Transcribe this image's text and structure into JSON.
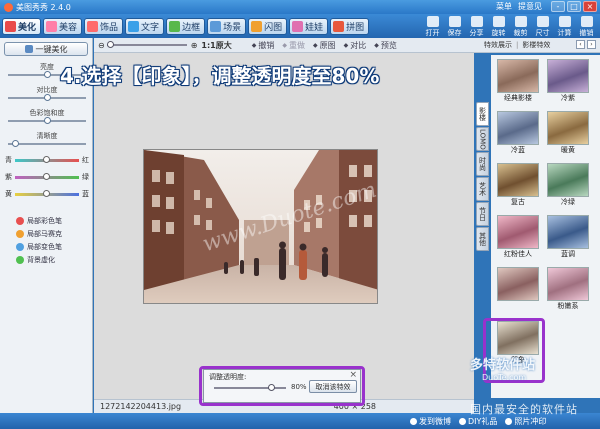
{
  "window": {
    "title": "美图秀秀 2.4.0",
    "menu": [
      "菜单",
      "提意见"
    ],
    "controls": [
      "-",
      "□",
      "×"
    ]
  },
  "tabs": [
    {
      "label": "美化",
      "color": "#e94b4b",
      "active": true
    },
    {
      "label": "美容",
      "color": "#ff7fa8",
      "active": false
    },
    {
      "label": "饰品",
      "color": "#ff6b6b",
      "active": false
    },
    {
      "label": "文字",
      "color": "#3aa0e8",
      "active": false
    },
    {
      "label": "边框",
      "color": "#58b84c",
      "active": false
    },
    {
      "label": "场景",
      "color": "#5c9ad8",
      "active": false
    },
    {
      "label": "闪图",
      "color": "#f0a030",
      "active": false
    },
    {
      "label": "娃娃",
      "color": "#e070b0",
      "active": false
    },
    {
      "label": "拼图",
      "color": "#e8583c",
      "active": false
    }
  ],
  "toolbar_buttons": [
    "打开",
    "保存",
    "分享",
    "旋转",
    "裁剪",
    "尺寸",
    "计算",
    "撤销"
  ],
  "left": {
    "one_click": "一键美化",
    "sliders": [
      {
        "label": "亮度",
        "value": 0.5
      },
      {
        "label": "对比度",
        "value": 0.5
      },
      {
        "label": "色彩饱和度",
        "value": 0.5
      },
      {
        "label": "清晰度",
        "value": 0.05
      }
    ],
    "color_rows": [
      {
        "left": "青",
        "right": "红",
        "gradient": [
          "#3cc8c8",
          "#e85050"
        ]
      },
      {
        "left": "紫",
        "right": "绿",
        "gradient": [
          "#c060c0",
          "#50c050"
        ]
      },
      {
        "left": "黄",
        "right": "蓝",
        "gradient": [
          "#e8d040",
          "#4a70e0"
        ]
      }
    ],
    "tools": [
      {
        "label": "局部彩色笔",
        "color": "#e85050"
      },
      {
        "label": "局部马赛克",
        "color": "#f0a030"
      },
      {
        "label": "局部变色笔",
        "color": "#50a0e0"
      },
      {
        "label": "背景虚化",
        "color": "#50c050"
      }
    ]
  },
  "work": {
    "zoom_text": "1:1原大",
    "actions": [
      {
        "label": "撤销",
        "dim": false
      },
      {
        "label": "重做",
        "dim": true
      },
      {
        "label": "原图",
        "dim": false
      },
      {
        "label": "对比",
        "dim": false
      },
      {
        "label": "预览",
        "dim": false
      }
    ],
    "watermark": "www.Duote.com",
    "filename": "1272142204413.jpg",
    "dimensions": "400 × 258"
  },
  "transparency": {
    "label": "调整透明度:",
    "value_text": "80%",
    "value": 0.8,
    "cancel": "取消该特效",
    "close": "×"
  },
  "right": {
    "header_tabs": [
      "特效展示",
      "影楼特效"
    ],
    "nav": [
      "‹",
      "›"
    ],
    "side_tabs": [
      "影楼",
      "LOMO",
      "时尚",
      "艺术",
      "节日",
      "其他"
    ],
    "thumbs": [
      {
        "caption": "经典影楼"
      },
      {
        "caption": "冷紫"
      },
      {
        "caption": "冷蓝"
      },
      {
        "caption": "暖黄"
      },
      {
        "caption": "复古"
      },
      {
        "caption": "冷绿"
      },
      {
        "caption": "红粉佳人"
      },
      {
        "caption": "蓝调"
      },
      {
        "caption": ""
      },
      {
        "caption": "粉嫩系"
      },
      {
        "caption": "印象"
      }
    ]
  },
  "headline": "4.选择【印象】，调整透明度至80%",
  "site_mark": {
    "line1": "多特软件站",
    "line2": "DuoTe.com",
    "line3": "国内最安全的软件站"
  },
  "bottombar": {
    "items": [
      "发到微博",
      "DIY礼品",
      "照片冲印"
    ]
  }
}
